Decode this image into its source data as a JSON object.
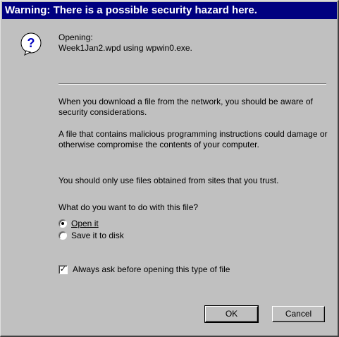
{
  "window": {
    "title": "Warning: There is a possible security hazard here."
  },
  "header": {
    "icon": "question-icon",
    "opening_label": "Opening:",
    "filename": "Week1Jan2.wpd using wpwin0.exe."
  },
  "body": {
    "paragraph1": "When you download a file from the network, you should be aware of security considerations.",
    "paragraph2": "A file that contains malicious programming instructions could damage or otherwise compromise the contents of your computer.",
    "paragraph3": "You should only use files obtained from sites that you trust.",
    "question": "What do you want to do with this file?"
  },
  "options": {
    "open_label": "Open it",
    "save_label": "Save it to disk",
    "selected": "open"
  },
  "checkbox": {
    "label": "Always ask before opening this type of file",
    "checked": true
  },
  "buttons": {
    "ok_label": "OK",
    "cancel_label": "Cancel"
  },
  "colors": {
    "titlebar": "#000080",
    "dialog_face": "#c0c0c0"
  }
}
